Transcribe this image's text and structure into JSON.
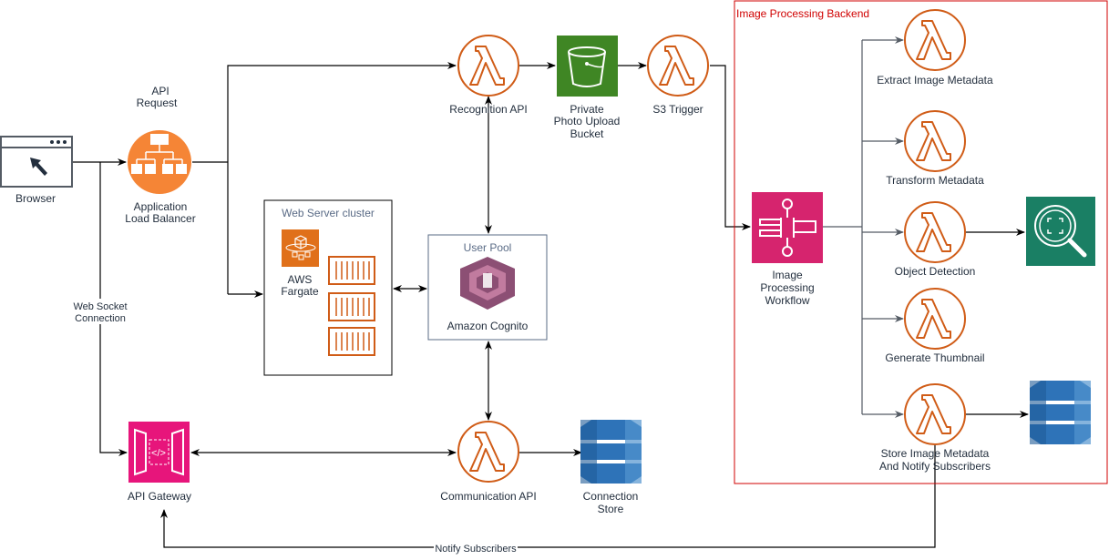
{
  "nodes": {
    "browser": {
      "label": "Browser",
      "icon": "browser-window-icon"
    },
    "alb": {
      "label1": "Application",
      "label2": "Load Balancer",
      "icon": "load-balancer-icon"
    },
    "api_request": {
      "line1": "API",
      "line2": "Request"
    },
    "web_socket": {
      "line1": "Web Socket",
      "line2": "Connection"
    },
    "recognition_api": {
      "label": "Recognition API",
      "icon": "lambda-icon"
    },
    "s3_bucket": {
      "line1": "Private",
      "line2": "Photo Upload",
      "line3": "Bucket",
      "icon": "s3-bucket-icon"
    },
    "s3_trigger": {
      "label": "S3 Trigger",
      "icon": "lambda-icon"
    },
    "web_server_cluster": {
      "title": "Web Server cluster",
      "fargate_line1": "AWS",
      "fargate_line2": "Fargate"
    },
    "user_pool": {
      "title": "User Pool",
      "label": "Amazon Cognito",
      "icon": "cognito-icon"
    },
    "api_gateway": {
      "label": "API Gateway",
      "icon": "api-gateway-icon"
    },
    "communication_api": {
      "label": "Communication API",
      "icon": "lambda-icon"
    },
    "connection_store": {
      "line1": "Connection",
      "line2": "Store",
      "icon": "dynamodb-icon"
    },
    "backend": {
      "title": "Image Processing Backend",
      "border_color": "#D00000"
    },
    "workflow": {
      "line1": "Image",
      "line2": "Processing",
      "line3": "Workflow",
      "icon": "step-functions-icon"
    },
    "lambdas": [
      {
        "label": "Extract Image Metadata"
      },
      {
        "label": "Transform Metadata"
      },
      {
        "label": "Object Detection"
      },
      {
        "label": "Generate Thumbnail"
      },
      {
        "label": "Store Image Metadata",
        "label2": "And Notify Subscribers"
      }
    ],
    "notify": {
      "label": "Notify Subscribers"
    }
  },
  "colors": {
    "lambda": "#D05C17",
    "s3": "#3F8624",
    "alb": "#F58536",
    "api_gateway": "#E7157B",
    "rekognition": "#1A7F64",
    "dynamodb": "#2E73B8",
    "cognito": "#8C4F74"
  }
}
